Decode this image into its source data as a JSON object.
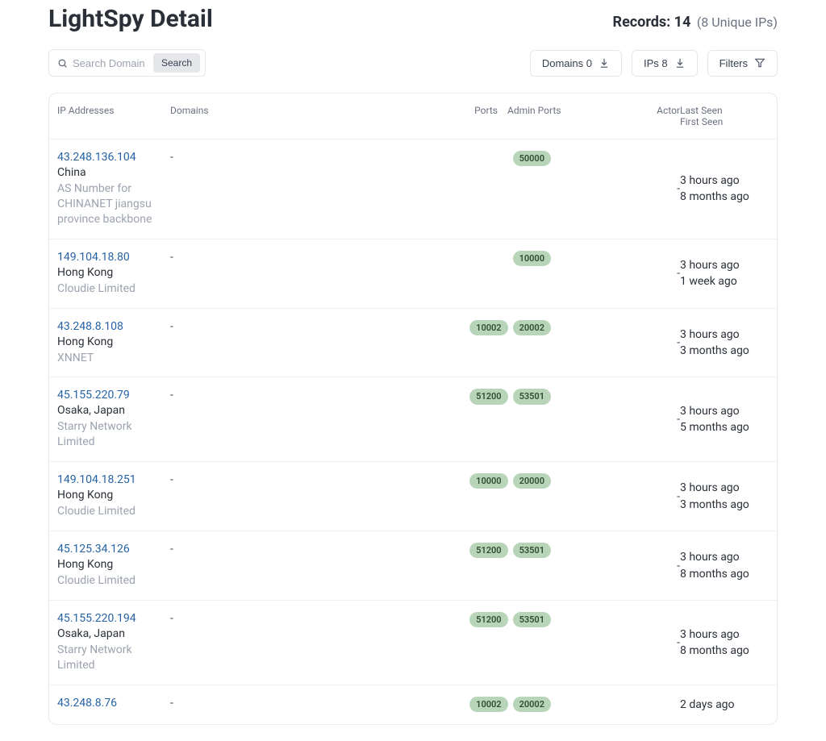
{
  "header": {
    "title": "LightSpy Detail",
    "records_prefix": "Records: ",
    "records_count": "14",
    "records_suffix": "(8 Unique IPs)"
  },
  "search": {
    "placeholder": "Search Domain",
    "button": "Search"
  },
  "buttons": {
    "domains": "Domains 0",
    "ips": "IPs 8",
    "filters": "Filters"
  },
  "columns": {
    "ip": "IP Addresses",
    "domains": "Domains",
    "ports": "Ports",
    "admin_ports": "Admin Ports",
    "actor": "Actor",
    "last_seen": "Last Seen",
    "first_seen": "First Seen"
  },
  "rows": [
    {
      "ip": "43.248.136.104",
      "location": "China",
      "org": "AS Number for CHINANET jiangsu province backbone",
      "domains": "-",
      "ports": [
        "50000"
      ],
      "actor": "-",
      "last_seen": "3 hours ago",
      "first_seen": "8 months ago"
    },
    {
      "ip": "149.104.18.80",
      "location": "Hong Kong",
      "org": "Cloudie Limited",
      "domains": "-",
      "ports": [
        "10000"
      ],
      "actor": "-",
      "last_seen": "3 hours ago",
      "first_seen": "1 week ago"
    },
    {
      "ip": "43.248.8.108",
      "location": "Hong Kong",
      "org": "XNNET",
      "domains": "-",
      "ports": [
        "10002",
        "20002"
      ],
      "actor": "-",
      "last_seen": "3 hours ago",
      "first_seen": "3 months ago"
    },
    {
      "ip": "45.155.220.79",
      "location": "Osaka, Japan",
      "org": "Starry Network Limited",
      "domains": "-",
      "ports": [
        "51200",
        "53501"
      ],
      "actor": "-",
      "last_seen": "3 hours ago",
      "first_seen": "5 months ago"
    },
    {
      "ip": "149.104.18.251",
      "location": "Hong Kong",
      "org": "Cloudie Limited",
      "domains": "-",
      "ports": [
        "10000",
        "20000"
      ],
      "actor": "-",
      "last_seen": "3 hours ago",
      "first_seen": "3 months ago"
    },
    {
      "ip": "45.125.34.126",
      "location": "Hong Kong",
      "org": "Cloudie Limited",
      "domains": "-",
      "ports": [
        "51200",
        "53501"
      ],
      "actor": "-",
      "last_seen": "3 hours ago",
      "first_seen": "8 months ago"
    },
    {
      "ip": "45.155.220.194",
      "location": "Osaka, Japan",
      "org": "Starry Network Limited",
      "domains": "-",
      "ports": [
        "51200",
        "53501"
      ],
      "actor": "-",
      "last_seen": "3 hours ago",
      "first_seen": "8 months ago"
    },
    {
      "ip": "43.248.8.76",
      "location": "",
      "org": "",
      "domains": "-",
      "ports": [
        "10002",
        "20002"
      ],
      "actor": "",
      "last_seen": "2 days ago",
      "first_seen": ""
    }
  ]
}
